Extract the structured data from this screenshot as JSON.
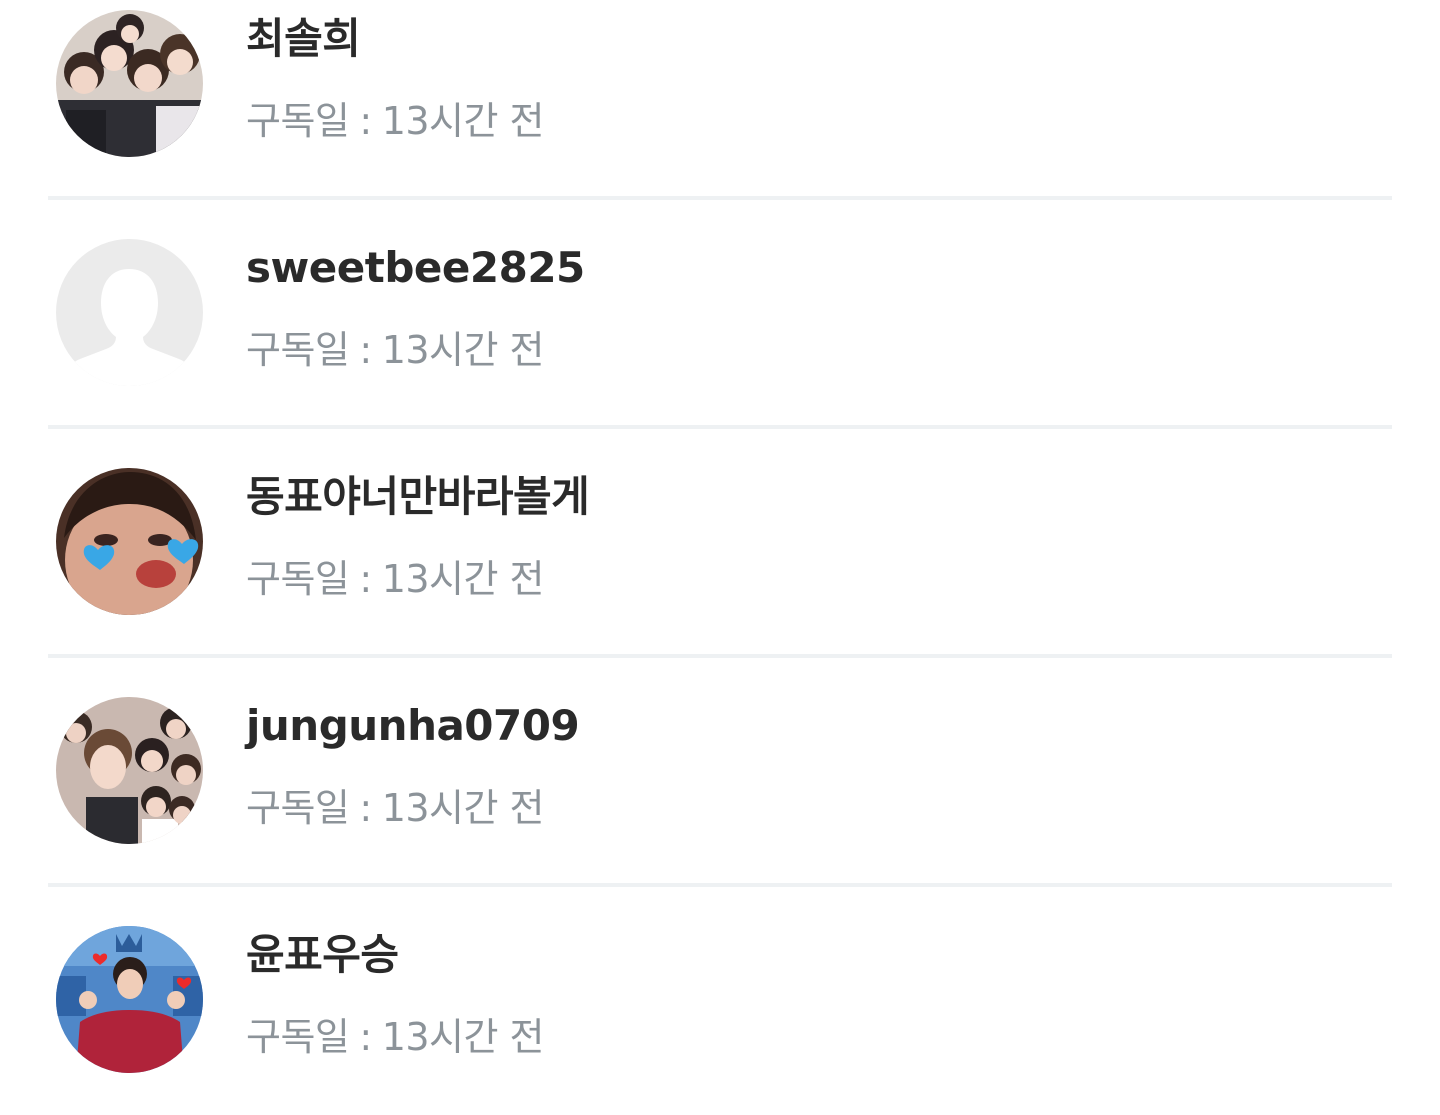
{
  "subscribers": [
    {
      "name": "최솔희",
      "meta_label": "구독일",
      "meta_sep": ":",
      "meta_value": "13시간 전",
      "avatar": "group-photo-avatar"
    },
    {
      "name": "sweetbee2825",
      "meta_label": "구독일",
      "meta_sep": ":",
      "meta_value": "13시간 전",
      "avatar": "default-profile-avatar"
    },
    {
      "name": "동표야너만바라볼게",
      "meta_label": "구독일",
      "meta_sep": ":",
      "meta_value": "13시간 전",
      "avatar": "face-photo-avatar"
    },
    {
      "name": "jungunha0709",
      "meta_label": "구독일",
      "meta_sep": ":",
      "meta_value": "13시간 전",
      "avatar": "group-photo-avatar"
    },
    {
      "name": "윤표우승",
      "meta_label": "구독일",
      "meta_sep": ":",
      "meta_value": "13시간 전",
      "avatar": "person-photo-avatar"
    }
  ],
  "colors": {
    "name": "#2a2a2a",
    "meta": "#8c9399",
    "divider": "#eef1f3",
    "default_avatar": "#ebebeb"
  }
}
